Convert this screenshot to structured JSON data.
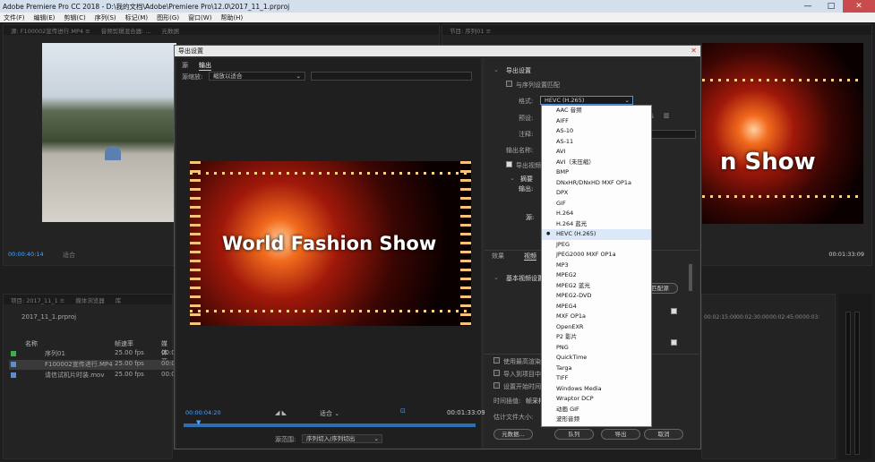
{
  "window": {
    "title": "Adobe Premiere Pro CC 2018 - D:\\我的文档\\Adobe\\Premiere Pro\\12.0\\2017_11_1.prproj",
    "min": "—",
    "max": "□",
    "close": "✕"
  },
  "menu": [
    "文件(F)",
    "编辑(E)",
    "剪辑(C)",
    "序列(S)",
    "标记(M)",
    "图形(G)",
    "窗口(W)",
    "帮助(H)"
  ],
  "source": {
    "tabs": [
      "源: F100002宣传进行.MP4 ≡",
      "音频剪辑混合器: ...",
      "元数据"
    ],
    "timecode": "00:00:40:14",
    "fit": "适合"
  },
  "program": {
    "tabs": [
      "节目: 序列01 ≡"
    ],
    "show_text": "n Show",
    "timecode": "00:01:33:09"
  },
  "project": {
    "tabs": [
      "项目: 2017_11_1 ≡",
      "媒体浏览器",
      "库"
    ],
    "file": "2017_11_1.prproj",
    "cols": [
      "名称",
      "帧速率",
      "媒体开"
    ],
    "rows": [
      {
        "name": "序列01",
        "fps": "25.00 fps",
        "start": "00:00:00",
        "color": "#3fae49"
      },
      {
        "name": "F100002宣传进行.MP4",
        "fps": "25.00 fps",
        "start": "00:00:00",
        "color": "#5d8ccf"
      },
      {
        "name": "请信试机片时装.mov",
        "fps": "25.00 fps",
        "start": "00:00:00",
        "color": "#5d8ccf"
      }
    ]
  },
  "timeline": {
    "ticks": [
      "00:02:15:00",
      "00:02:30:00",
      "00:02:45:00",
      "00:03:"
    ]
  },
  "dialog": {
    "title": "导出设置",
    "close": "✕",
    "tabs": [
      "源",
      "输出"
    ],
    "source_scale_label": "源缩放:",
    "source_scale": "缩放以适合",
    "video_text": "World Fashion Show",
    "tc_start": "00:00:04:20",
    "tc_end": "00:01:33:09",
    "fit": "适合",
    "range_label": "源范围:",
    "range": "序列切入/序列切出",
    "export_settings": "导出设置",
    "match_seq": "与序列设置匹配",
    "format_label": "格式:",
    "format_value": "HEVC (H.265)",
    "preset_label": "预设:",
    "comment_label": "注释:",
    "output_name_label": "输出名称:",
    "export_video": "导出视频",
    "summary_label": "摘要",
    "summary_out": "输出:",
    "summary_src": "源:",
    "effects_tabs": [
      "效果",
      "视频"
    ],
    "basic_video": "基本视频设置",
    "match_source": "匹配源",
    "use_max_quality": "使用最高渲染质量",
    "use_previews": "导入到项目中",
    "set_start_tc": "设置开始时间码",
    "time_interp": "时间插值:",
    "time_interp_val": "帧采样",
    "est_size": "估计文件大小:",
    "buttons": {
      "metadata": "元数据...",
      "queue": "队列",
      "export": "导出",
      "cancel": "取消"
    }
  },
  "format_options": [
    "AAC 音频",
    "AIFF",
    "AS-10",
    "AS-11",
    "AVI",
    "AVI（未压缩）",
    "BMP",
    "DNxHR/DNxHD MXF OP1a",
    "DPX",
    "GIF",
    "H.264",
    "H.264 蓝光",
    "HEVC (H.265)",
    "JPEG",
    "JPEG2000 MXF OP1a",
    "MP3",
    "MPEG2",
    "MPEG2 蓝光",
    "MPEG2-DVD",
    "MPEG4",
    "MXF OP1a",
    "OpenEXR",
    "P2 影片",
    "PNG",
    "QuickTime",
    "Targa",
    "TIFF",
    "Windows Media",
    "Wraptor DCP",
    "动画 GIF",
    "波形音频"
  ],
  "selected_format_index": 12
}
